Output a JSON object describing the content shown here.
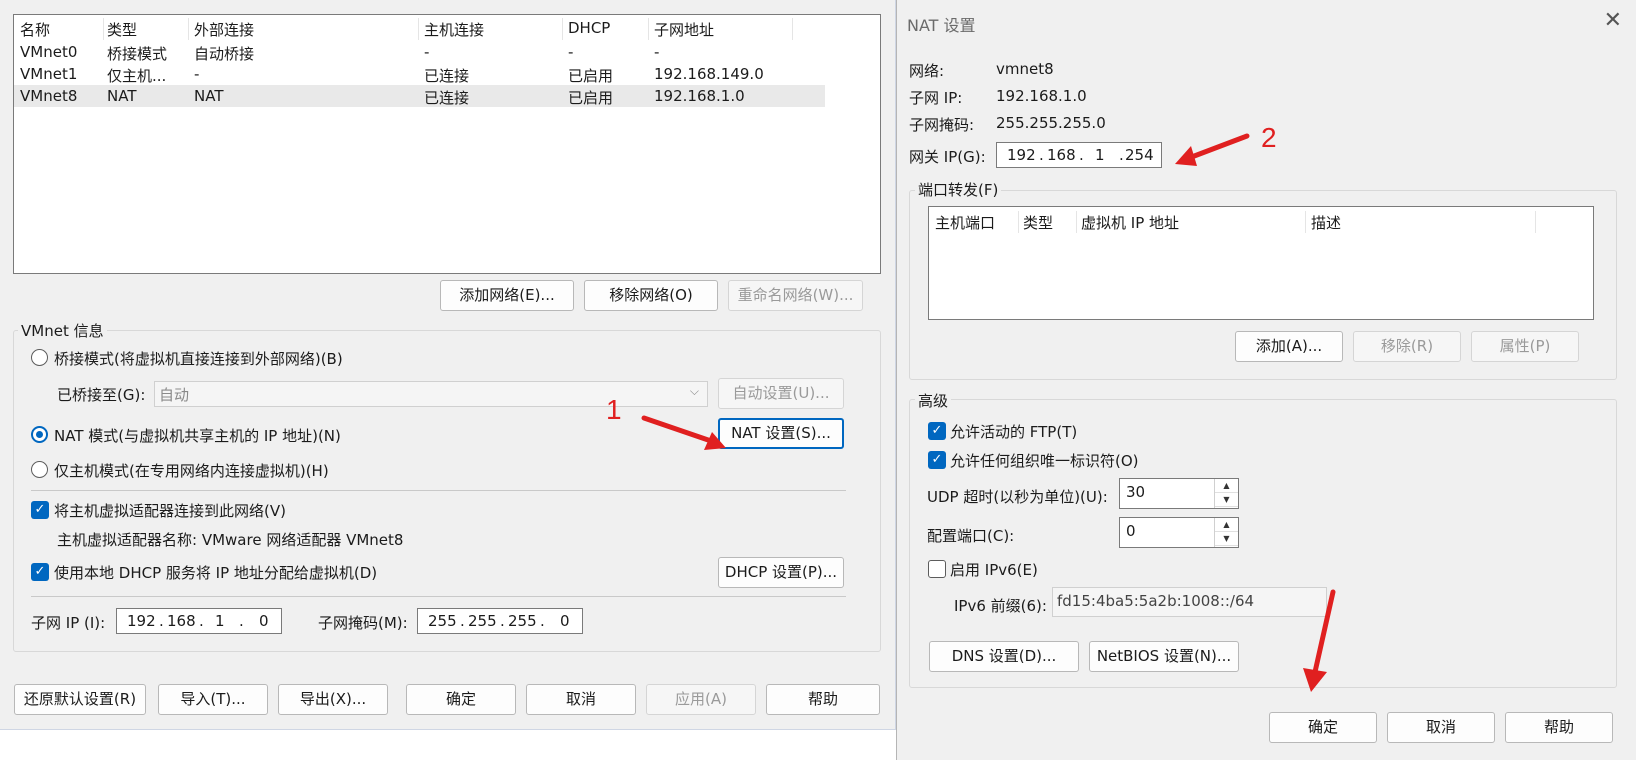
{
  "left": {
    "table": {
      "headers": [
        "名称",
        "类型",
        "外部连接",
        "主机连接",
        "DHCP",
        "子网地址"
      ],
      "rows": [
        [
          "VMnet0",
          "桥接模式",
          "自动桥接",
          "-",
          "-",
          "-"
        ],
        [
          "VMnet1",
          "仅主机...",
          "-",
          "已连接",
          "已启用",
          "192.168.149.0"
        ],
        [
          "VMnet8",
          "NAT",
          "NAT",
          "已连接",
          "已启用",
          "192.168.1.0"
        ]
      ]
    },
    "buttons": {
      "add_network": "添加网络(E)...",
      "remove_network": "移除网络(O)",
      "rename_network": "重命名网络(W)...",
      "auto_settings": "自动设置(U)...",
      "nat_settings": "NAT 设置(S)...",
      "dhcp_settings": "DHCP 设置(P)...",
      "restore_defaults": "还原默认设置(R)",
      "import": "导入(T)...",
      "export": "导出(X)...",
      "ok": "确定",
      "cancel": "取消",
      "apply": "应用(A)",
      "help": "帮助"
    },
    "vmnet_info": {
      "title": "VMnet 信息",
      "bridged_mode": "桥接模式(将虚拟机直接连接到外部网络)(B)",
      "bridged_to_label": "已桥接至(G):",
      "bridged_to_value": "自动",
      "nat_mode": "NAT 模式(与虚拟机共享主机的 IP 地址)(N)",
      "host_only_mode": "仅主机模式(在专用网络内连接虚拟机)(H)",
      "connect_adapter": "将主机虚拟适配器连接到此网络(V)",
      "adapter_name": "主机虚拟适配器名称: VMware 网络适配器 VMnet8",
      "use_dhcp": "使用本地 DHCP 服务将 IP 地址分配给虚拟机(D)",
      "subnet_ip_label": "子网 IP (I):",
      "subnet_ip": [
        "192",
        "168",
        "1",
        "0"
      ],
      "subnet_mask_label": "子网掩码(M):",
      "subnet_mask": [
        "255",
        "255",
        "255",
        "0"
      ]
    },
    "annotation": "1"
  },
  "right": {
    "title": "NAT 设置",
    "network_label": "网络:",
    "network_value": "vmnet8",
    "subnet_ip_label": "子网 IP:",
    "subnet_ip_value": "192.168.1.0",
    "subnet_mask_label": "子网掩码:",
    "subnet_mask_value": "255.255.255.0",
    "gateway_label": "网关 IP(G):",
    "gateway_ip": [
      "192",
      "168",
      "1",
      "254"
    ],
    "annotation": "2",
    "port_forwarding": {
      "title": "端口转发(F)",
      "headers": [
        "主机端口",
        "类型",
        "虚拟机 IP 地址",
        "描述"
      ],
      "add": "添加(A)...",
      "remove": "移除(R)",
      "properties": "属性(P)"
    },
    "advanced": {
      "title": "高级",
      "allow_ftp": "允许活动的 FTP(T)",
      "allow_oui": "允许任何组织唯一标识符(O)",
      "udp_timeout_label": "UDP 超时(以秒为单位)(U):",
      "udp_timeout": "30",
      "config_port_label": "配置端口(C):",
      "config_port": "0",
      "enable_ipv6": "启用 IPv6(E)",
      "ipv6_prefix_label": "IPv6 前缀(6):",
      "ipv6_prefix": "fd15:4ba5:5a2b:1008::/64"
    },
    "dns_settings": "DNS 设置(D)...",
    "netbios_settings": "NetBIOS 设置(N)...",
    "ok": "确定",
    "cancel": "取消",
    "help": "帮助"
  },
  "colors": {
    "accent": "#0067c0",
    "annotation": "#e02020"
  }
}
